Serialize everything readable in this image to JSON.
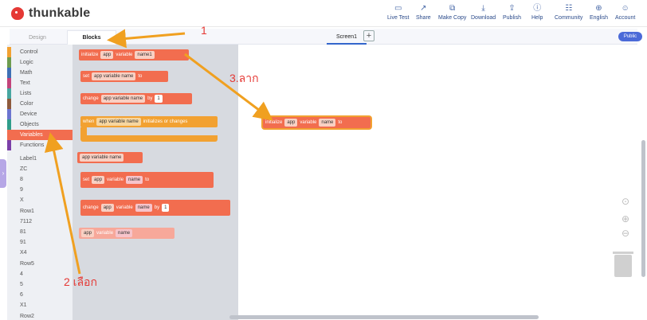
{
  "app": {
    "brand": "thunkable"
  },
  "topnav": [
    {
      "label": "Live Test",
      "icon": "▭"
    },
    {
      "label": "Share",
      "icon": "↗"
    },
    {
      "label": "Make Copy",
      "icon": "⧉"
    },
    {
      "label": "Download",
      "icon": "⤓"
    },
    {
      "label": "Publish",
      "icon": "⇪"
    },
    {
      "label": "Help",
      "icon": "ⓘ"
    },
    {
      "label": "Community",
      "icon": "☷"
    },
    {
      "label": "English",
      "icon": "⊕"
    },
    {
      "label": "Account",
      "icon": "☺"
    }
  ],
  "tabs": {
    "design": "Design",
    "blocks": "Blocks",
    "screen": "Screen1",
    "add": "+"
  },
  "badge": {
    "public": "Public"
  },
  "categories": [
    {
      "label": "Control",
      "color": "#f2a131"
    },
    {
      "label": "Logic",
      "color": "#6d9c4f"
    },
    {
      "label": "Math",
      "color": "#3e6fb5"
    },
    {
      "label": "Text",
      "color": "#c2447a"
    },
    {
      "label": "Lists",
      "color": "#47a6a0"
    },
    {
      "label": "Color",
      "color": "#8e5a3c"
    },
    {
      "label": "Device",
      "color": "#6b74d0"
    },
    {
      "label": "Objects",
      "color": "#2f9d8a"
    },
    {
      "label": "Variables",
      "color": "#f26d4f"
    },
    {
      "label": "Functions",
      "color": "#7b3fa8"
    }
  ],
  "components": [
    "Label1",
    "ZC",
    "8",
    "9",
    "X",
    "Row1",
    "7112",
    "81",
    "91",
    "X4",
    "Row5",
    "4",
    "5",
    "6",
    "X1",
    "Row2"
  ],
  "blocks": {
    "init": {
      "kw": "initialize",
      "scope": "app",
      "var": "variable",
      "name": "name1"
    },
    "set": {
      "kw": "set",
      "name": "app variable name",
      "to": "to"
    },
    "change": {
      "kw": "change",
      "name": "app variable name",
      "by": "by",
      "num": "1"
    },
    "when": {
      "kw": "when",
      "name": "app variable name",
      "tail": "initializes or changes"
    },
    "getter": {
      "name": "app variable name"
    },
    "set2": {
      "kw": "set",
      "scope": "app",
      "var": "variable",
      "name": "name",
      "to": "to"
    },
    "change2": {
      "kw": "change",
      "scope": "app",
      "var": "variable",
      "name": "name",
      "by": "by",
      "num": "1"
    },
    "get2": {
      "scope": "app",
      "var": "variable",
      "name": "name"
    },
    "dragged": {
      "kw": "initialize",
      "scope": "app",
      "var": "variable",
      "name": "name",
      "to": "to"
    }
  },
  "annotations": {
    "step1": "1",
    "step2": "2 เลือก",
    "step3": "3.ลาก"
  }
}
